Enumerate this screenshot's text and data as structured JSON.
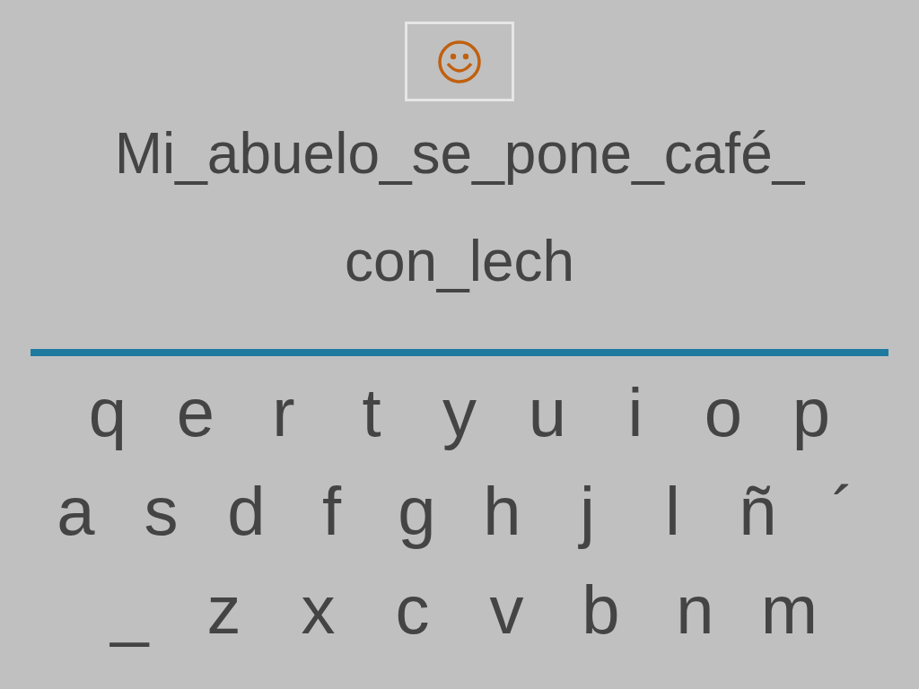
{
  "prompt_lines": [
    "Mi_abuelo_se_pone_café_",
    "con_lech"
  ],
  "keyboard_rows": [
    [
      "q",
      "e",
      "r",
      "t",
      "y",
      "u",
      "i",
      "o",
      "p"
    ],
    [
      "a",
      "s",
      "d",
      "f",
      "g",
      "h",
      "j",
      "l",
      "ñ",
      "´"
    ],
    [
      "_",
      "z",
      "x",
      "c",
      "v",
      "b",
      "n",
      "m"
    ]
  ]
}
